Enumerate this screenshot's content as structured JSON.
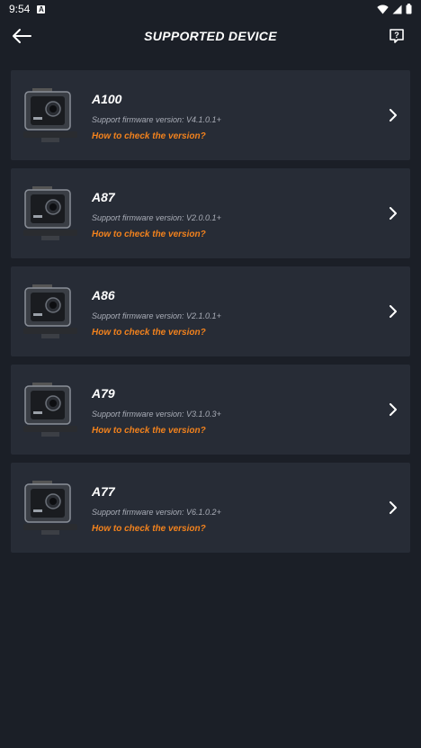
{
  "status": {
    "time": "9:54"
  },
  "header": {
    "title": "SUPPORTED DEVICE"
  },
  "devices": [
    {
      "name": "A100",
      "firmware": "Support firmware version: V4.1.0.1+",
      "how_link": "How to check the version?"
    },
    {
      "name": "A87",
      "firmware": "Support firmware version: V2.0.0.1+",
      "how_link": "How to check the version?"
    },
    {
      "name": "A86",
      "firmware": "Support firmware version: V2.1.0.1+",
      "how_link": "How to check the version?"
    },
    {
      "name": "A79",
      "firmware": "Support firmware version: V3.1.0.3+",
      "how_link": "How to check the version?"
    },
    {
      "name": "A77",
      "firmware": "Support firmware version: V6.1.0.2+",
      "how_link": "How to check the version?"
    }
  ],
  "colors": {
    "background": "#1b1f27",
    "card": "#272c36",
    "accent": "#f2821d"
  }
}
